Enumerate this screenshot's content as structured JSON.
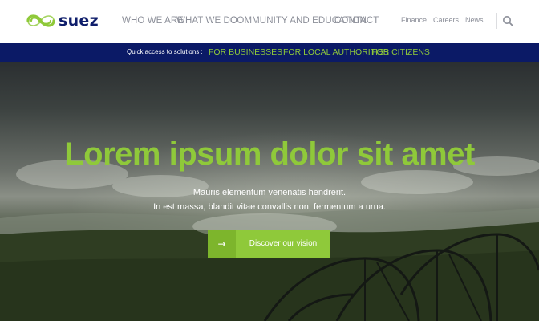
{
  "brand": {
    "logo_text": "suez",
    "logo_colors": {
      "swirl": "#8fc93a",
      "text": "#0f1e6b"
    }
  },
  "main_nav": {
    "items": [
      "WHO WE ARE",
      "WHAT WE DO",
      "COMMUNITY AND EDUCATION",
      "CONTACT"
    ]
  },
  "utility_nav": {
    "items": [
      "Finance",
      "Careers",
      "News"
    ],
    "search_icon": "search-icon"
  },
  "quick_access": {
    "label": "Quick access to solutions :",
    "links": [
      "FOR BUSINESSES",
      "FOR LOCAL AUTHORITIES",
      "FOR CITIZENS"
    ]
  },
  "hero": {
    "title": "Lorem ipsum dolor sit amet",
    "subtitle_line1": "Mauris elementum venenatis hendrerit.",
    "subtitle_line2": "In est massa, blandit vitae convallis non, fermentum a urna.",
    "cta_arrow": "→",
    "cta_label": "Discover our vision"
  },
  "colors": {
    "accent_green": "#8fc93a",
    "navy": "#0b1a66",
    "nav_text": "#8c8f99"
  }
}
